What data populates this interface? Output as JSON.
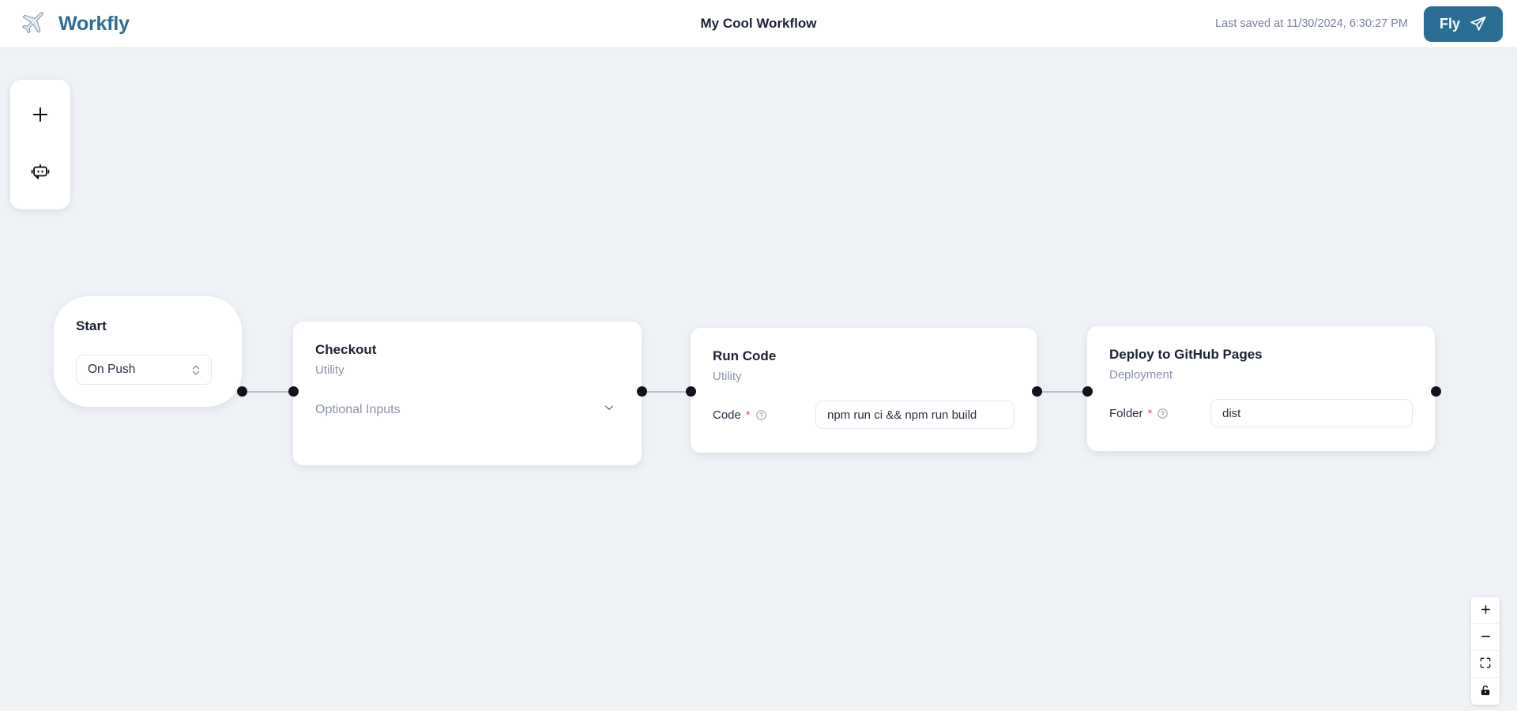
{
  "header": {
    "logo_icon": "airplane-icon",
    "brand": "Workfly",
    "workflow_title": "My Cool Workflow",
    "last_saved": "Last saved at 11/30/2024, 6:30:27 PM",
    "fly_label": "Fly",
    "fly_icon": "send-icon",
    "fly_color": "#2b6d94"
  },
  "toolbar": {
    "add_icon": "plus-icon",
    "assistant_icon": "robot-chat-icon"
  },
  "canvas": {
    "background_color": "#eef1f5",
    "grid_dot_color": "#dcdfe6",
    "edge_color": "#b9bfcb",
    "handle_color": "#12131a"
  },
  "nodes": [
    {
      "id": "start",
      "title": "Start",
      "subtitle": "",
      "trigger": {
        "value": "On Push",
        "icon": "chevron-up-down-icon"
      }
    },
    {
      "id": "checkout",
      "title": "Checkout",
      "subtitle": "Utility",
      "optional_inputs": {
        "label": "Optional Inputs",
        "icon": "chevron-down-icon"
      }
    },
    {
      "id": "runcode",
      "title": "Run Code",
      "subtitle": "Utility",
      "field": {
        "label": "Code",
        "required_marker": "*",
        "help_icon": "help-circle-icon",
        "value": "npm run ci && npm run build"
      }
    },
    {
      "id": "deploy",
      "title": "Deploy to GitHub Pages",
      "subtitle": "Deployment",
      "field": {
        "label": "Folder",
        "required_marker": "*",
        "help_icon": "help-circle-icon",
        "value": "dist"
      }
    }
  ],
  "zoom_controls": {
    "zoom_in_icon": "plus-icon",
    "zoom_out_icon": "minus-icon",
    "fit_view_icon": "fit-view-icon",
    "lock_icon": "unlock-icon"
  }
}
